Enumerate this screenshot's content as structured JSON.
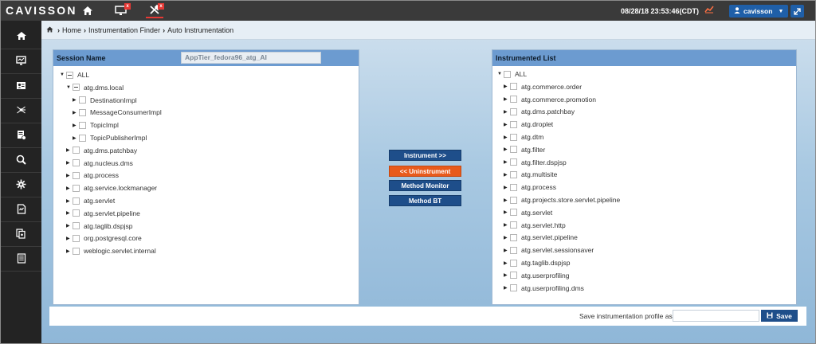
{
  "app": {
    "logo": "CAVISSON",
    "datetime": "08/28/18 23:53:46(CDT)",
    "user": "cavisson"
  },
  "icons": {
    "home": "home-icon",
    "monitor": "monitor-icon",
    "tools": "tools-icon",
    "alert": "alert-icon",
    "expand": "expand-icon"
  },
  "sidebar": {
    "items": [
      {
        "icon": "home-icon"
      },
      {
        "icon": "dashboard-icon"
      },
      {
        "icon": "id-card-icon"
      },
      {
        "icon": "network-icon"
      },
      {
        "icon": "report-icon"
      },
      {
        "icon": "search-icon"
      },
      {
        "icon": "settings-icon"
      },
      {
        "icon": "document-icon"
      },
      {
        "icon": "files-icon"
      },
      {
        "icon": "list-icon"
      }
    ]
  },
  "breadcrumb": [
    "Home",
    "Instrumentation Finder",
    "Auto Instrumentation"
  ],
  "left_panel": {
    "title": "Session Name",
    "session_value": "AppTier_fedora96_atg_AI",
    "nodes": [
      {
        "label": "ALL",
        "level": 0,
        "expanded": true,
        "partial": true
      },
      {
        "label": "atg.dms.local",
        "level": 1,
        "expanded": true,
        "partial": true
      },
      {
        "label": "DestinationImpl",
        "level": 2
      },
      {
        "label": "MessageConsumerImpl",
        "level": 2
      },
      {
        "label": "TopicImpl",
        "level": 2
      },
      {
        "label": "TopicPublisherImpl",
        "level": 2
      },
      {
        "label": "atg.dms.patchbay",
        "level": 1
      },
      {
        "label": "atg.nucleus.dms",
        "level": 1
      },
      {
        "label": "atg.process",
        "level": 1
      },
      {
        "label": "atg.service.lockmanager",
        "level": 1
      },
      {
        "label": "atg.servlet",
        "level": 1
      },
      {
        "label": "atg.servlet.pipeline",
        "level": 1
      },
      {
        "label": "atg.taglib.dspjsp",
        "level": 1
      },
      {
        "label": "org.postgresql.core",
        "level": 1
      },
      {
        "label": "weblogic.servlet.internal",
        "level": 1
      }
    ]
  },
  "buttons": {
    "instrument": "Instrument >>",
    "uninstrument": "<< Uninstrument",
    "method_monitor": "Method Monitor",
    "method_bt": "Method BT"
  },
  "right_panel": {
    "title": "Instrumented List",
    "nodes": [
      {
        "label": "ALL",
        "level": 0,
        "expanded": true
      },
      {
        "label": "atg.commerce.order",
        "level": 1
      },
      {
        "label": "atg.commerce.promotion",
        "level": 1
      },
      {
        "label": "atg.dms.patchbay",
        "level": 1
      },
      {
        "label": "atg.droplet",
        "level": 1
      },
      {
        "label": "atg.dtm",
        "level": 1
      },
      {
        "label": "atg.filter",
        "level": 1
      },
      {
        "label": "atg.filter.dspjsp",
        "level": 1
      },
      {
        "label": "atg.multisite",
        "level": 1
      },
      {
        "label": "atg.process",
        "level": 1
      },
      {
        "label": "atg.projects.store.servlet.pipeline",
        "level": 1
      },
      {
        "label": "atg.servlet",
        "level": 1
      },
      {
        "label": "atg.servlet.http",
        "level": 1
      },
      {
        "label": "atg.servlet.pipeline",
        "level": 1
      },
      {
        "label": "atg.servlet.sessionsaver",
        "level": 1
      },
      {
        "label": "atg.taglib.dspjsp",
        "level": 1
      },
      {
        "label": "atg.userprofiling",
        "level": 1
      },
      {
        "label": "atg.userprofiling.dms",
        "level": 1
      }
    ]
  },
  "save": {
    "label": "Save instrumentation profile as",
    "value": "",
    "button": "Save"
  },
  "colors": {
    "accent": "#1e4e8a",
    "uninstrument": "#e85a1b",
    "panel_header": "#6c9bd0",
    "sidebar": "#232323"
  }
}
